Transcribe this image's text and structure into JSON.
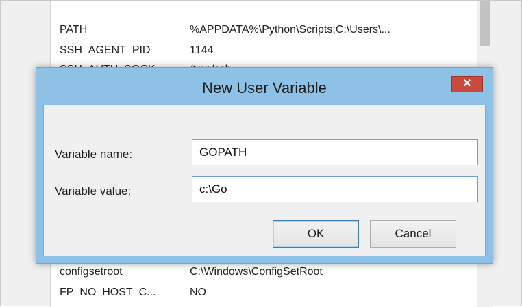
{
  "background": {
    "variables": [
      {
        "name": "PATH",
        "value": "%APPDATA%\\Python\\Scripts;C:\\Users\\..."
      },
      {
        "name": "SSH_AGENT_PID",
        "value": "1144"
      },
      {
        "name": "SSH_AUTH_SOCK",
        "value": "/tmp/ssh-..."
      },
      {
        "name": "configsetroot",
        "value": "C:\\Windows\\ConfigSetRoot"
      },
      {
        "name": "FP_NO_HOST_C...",
        "value": "NO"
      }
    ]
  },
  "dialog": {
    "title": "New User Variable",
    "close_label": "✕",
    "name_label_pre": "Variable ",
    "name_label_key": "n",
    "name_label_post": "ame:",
    "name_value": "GOPATH",
    "value_label_pre": "Variable ",
    "value_label_key": "v",
    "value_label_post": "alue:",
    "value_value": "c:\\Go",
    "ok_label": "OK",
    "cancel_label": "Cancel"
  },
  "colors": {
    "dialog_frame": "#8ec1e6",
    "close_button": "#c74a3c"
  }
}
